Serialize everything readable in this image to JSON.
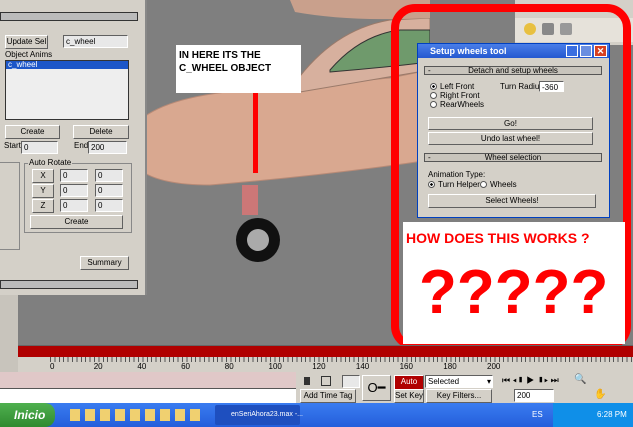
{
  "left_panel": {
    "update_sel": "Update Sel",
    "sel_value": "c_wheel",
    "object_anims_label": "Object Anims",
    "anims": [
      "c_wheel"
    ],
    "create": "Create",
    "delete": "Delete",
    "start_label": "Start",
    "start": "0",
    "end_label": "End",
    "end": "200",
    "auto_rotate": "Auto Rotate",
    "axes": [
      {
        "label": "X",
        "a": "0",
        "b": "0"
      },
      {
        "label": "Y",
        "a": "0",
        "b": "0"
      },
      {
        "label": "Z",
        "a": "0",
        "b": "0"
      }
    ],
    "ar_create": "Create",
    "summary": "Summary"
  },
  "annotation": {
    "line1": "IN HERE ITS THE",
    "line2": "C_WHEEL OBJECT",
    "question": "HOW DOES THIS WORKS ?",
    "marks": "?????"
  },
  "dialog": {
    "title": "Setup wheels tool",
    "section1": "Detach and setup wheels",
    "radios": [
      {
        "label": "Left Front",
        "on": true
      },
      {
        "label": "Right Front",
        "on": false
      },
      {
        "label": "RearWheels",
        "on": false
      }
    ],
    "turn_radius_label": "Turn Radius:",
    "turn_radius": "-360",
    "go": "Go!",
    "undo": "Undo last wheel!",
    "section2": "Wheel selection",
    "anim_type_label": "Animation Type:",
    "anim_types": [
      {
        "label": "Turn Helper",
        "on": true
      },
      {
        "label": "Wheels",
        "on": false
      }
    ],
    "select": "Select Wheels!",
    "collapse": "-"
  },
  "timeline": {
    "ticks": [
      "0",
      "20",
      "40",
      "60",
      "80",
      "100",
      "120",
      "140",
      "160",
      "180",
      "200"
    ]
  },
  "controls": {
    "add_time_tag": "Add Time Tag",
    "auto_key": "Auto Key",
    "selected": "Selected",
    "set_key": "Set Key",
    "key_filters": "Key Filters...",
    "frame": "200"
  },
  "taskbar": {
    "start": "Inicio",
    "task": "enSeriAhora23.max -...",
    "lang": "ES",
    "time": "6:28 PM"
  },
  "colors": {
    "annot_red": "#ff0000",
    "ui_gray": "#d4d0c8",
    "xp_blue": "#245edb",
    "autokey": "#b00000"
  }
}
